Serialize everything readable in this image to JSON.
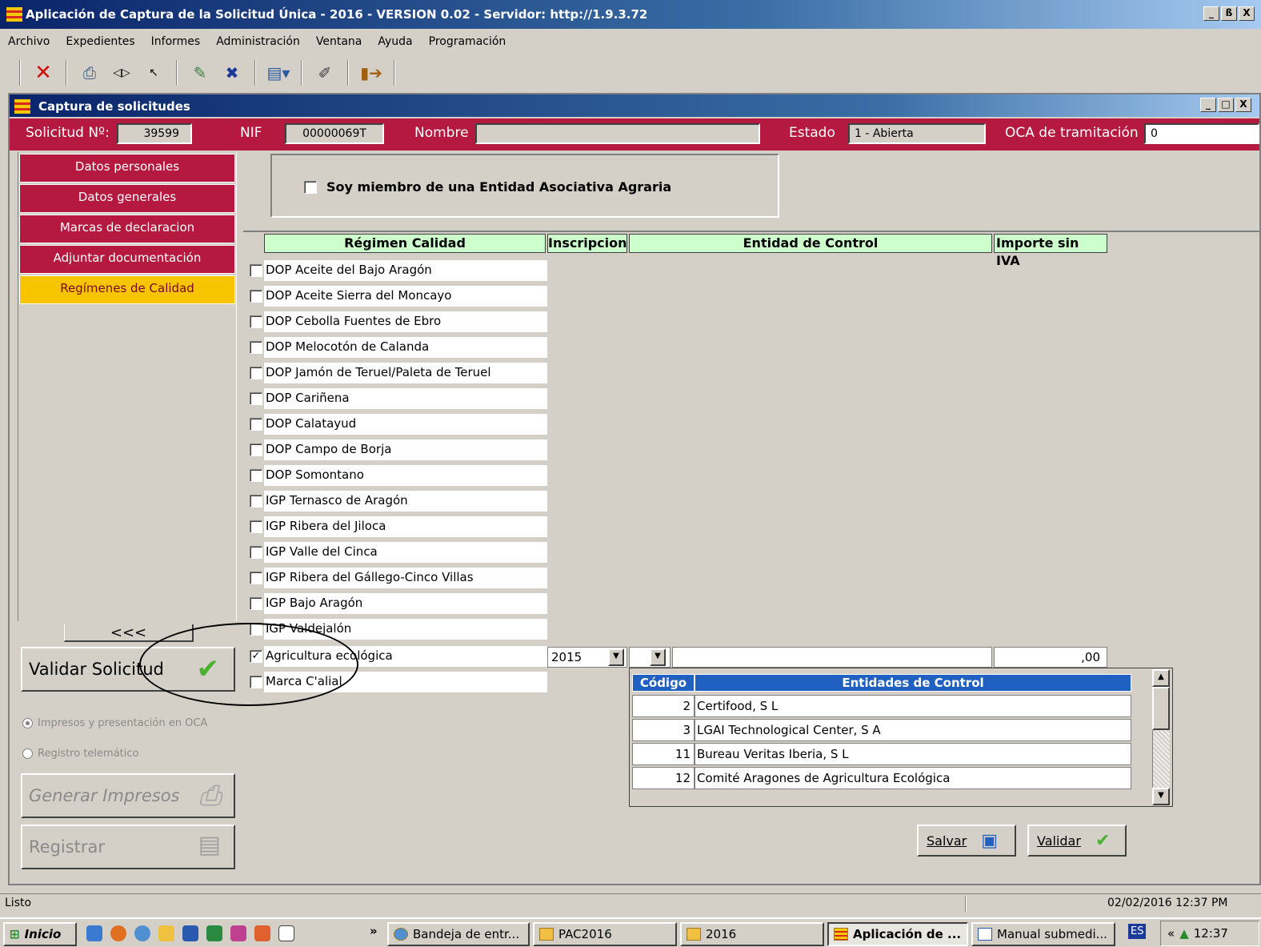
{
  "window": {
    "title": "Aplicación de Captura de la Solicitud Única - 2016 - VERSION 0.02 - Servidor: http://1.9.3.72",
    "btn_min": "_",
    "btn_max": "ß",
    "btn_close": "X"
  },
  "menu": [
    "Archivo",
    "Expedientes",
    "Informes",
    "Administración",
    "Ventana",
    "Ayuda",
    "Programación"
  ],
  "inner": {
    "title": "Captura de solicitudes",
    "btn_min": "_",
    "btn_max": "□",
    "btn_close": "X"
  },
  "header": {
    "solicitud_label": "Solicitud Nº:",
    "solicitud_value": "39599",
    "nif_label": "NIF",
    "nif_value": "00000069T",
    "nombre_label": "Nombre",
    "nombre_value": "",
    "estado_label": "Estado",
    "estado_value": "1 - Abierta",
    "oca_label": "OCA de tramitación",
    "oca_value": "0"
  },
  "nav": {
    "items": [
      "Datos personales",
      "Datos generales",
      "Marcas de declaracion",
      "Adjuntar documentación",
      "Regímenes de Calidad"
    ],
    "active": "Regímenes de Calidad",
    "collapse": "<<<"
  },
  "side": {
    "validar": "Validar Solicitud",
    "radio1": "Impresos y presentación en OCA",
    "radio2": "Registro telemático",
    "generar": "Generar Impresos",
    "registrar": "Registrar"
  },
  "assoc": {
    "label": "Soy miembro de una Entidad Asociativa Agraria",
    "checked": false
  },
  "grid": {
    "columns": [
      "Régimen Calidad",
      "Inscripcion",
      "Entidad de Control",
      "Importe sin IVA"
    ],
    "rows": [
      {
        "name": "DOP Aceite del Bajo Aragón",
        "checked": false
      },
      {
        "name": "DOP Aceite Sierra del Moncayo",
        "checked": false
      },
      {
        "name": "DOP Cebolla Fuentes de Ebro",
        "checked": false
      },
      {
        "name": "DOP Melocotón de Calanda",
        "checked": false
      },
      {
        "name": "DOP Jamón de Teruel/Paleta de Teruel",
        "checked": false
      },
      {
        "name": "DOP Cariñena",
        "checked": false
      },
      {
        "name": "DOP Calatayud",
        "checked": false
      },
      {
        "name": "DOP Campo de Borja",
        "checked": false
      },
      {
        "name": "DOP Somontano",
        "checked": false
      },
      {
        "name": "IGP Ternasco de Aragón",
        "checked": false
      },
      {
        "name": "IGP Ribera del Jiloca",
        "checked": false
      },
      {
        "name": "IGP Valle del Cinca",
        "checked": false
      },
      {
        "name": "IGP Ribera del Gállego-Cinco Villas",
        "checked": false
      },
      {
        "name": "IGP Bajo Aragón",
        "checked": false
      },
      {
        "name": "IGP Valdejalón",
        "checked": false
      },
      {
        "name": "Agricultura ecológica",
        "checked": true
      },
      {
        "name": "Marca C'alial",
        "checked": false
      }
    ],
    "selected_inscripcion": "2015",
    "selected_importe": ",00"
  },
  "dropdown": {
    "col_code": "Código",
    "col_name": "Entidades de Control",
    "items": [
      {
        "code": "2",
        "name": "Certifood, S L"
      },
      {
        "code": "3",
        "name": "LGAI Technological Center, S A"
      },
      {
        "code": "11",
        "name": "Bureau Veritas Iberia, S L"
      },
      {
        "code": "12",
        "name": "Comité Aragones de Agricultura Ecológica"
      }
    ]
  },
  "actions": {
    "salvar": "Salvar",
    "validar": "Validar"
  },
  "status": {
    "left": "Listo",
    "datetime": "02/02/2016 12:37 PM"
  },
  "taskbar": {
    "start": "Inicio",
    "more": "»",
    "tasks": [
      "Bandeja de entr...",
      "PAC2016",
      "2016",
      "Aplicación de ...",
      "Manual submedi..."
    ],
    "lang": "ES",
    "tray_more": "«",
    "clock": "12:37"
  },
  "colors": {
    "brand_red": "#b5193f",
    "active_tab": "#f7c400",
    "grid_header": "#ccffcc",
    "list_header": "#2060c0"
  }
}
